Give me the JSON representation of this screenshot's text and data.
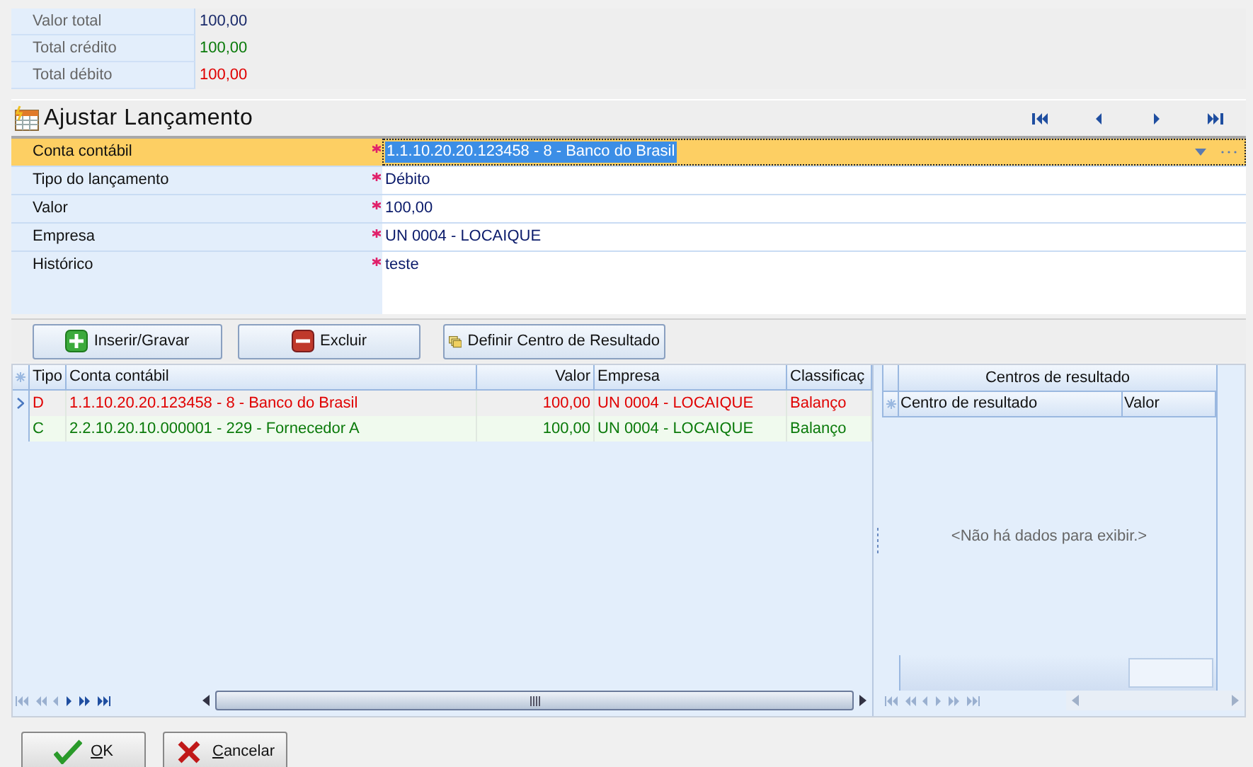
{
  "summary": [
    {
      "label": "Valor total",
      "value": "100,00",
      "kind": "total"
    },
    {
      "label": "Total crédito",
      "value": "100,00",
      "kind": "credit"
    },
    {
      "label": "Total débito",
      "value": "100,00",
      "kind": "debit"
    }
  ],
  "panel": {
    "title": "Ajustar Lançamento"
  },
  "form": {
    "fields": [
      {
        "label": "Conta contábil",
        "required": true,
        "value": "1.1.10.20.20.123458 - 8 - Banco do Brasil",
        "selected": true,
        "kind": "lookup"
      },
      {
        "label": "Tipo do lançamento",
        "required": true,
        "value": "Débito",
        "selected": false,
        "kind": "text"
      },
      {
        "label": "Valor",
        "required": true,
        "value": "100,00",
        "selected": false,
        "kind": "text"
      },
      {
        "label": "Empresa",
        "required": true,
        "value": "UN 0004 - LOCAIQUE",
        "selected": false,
        "kind": "text"
      },
      {
        "label": "Histórico",
        "required": true,
        "value": "teste",
        "selected": false,
        "kind": "memo"
      }
    ]
  },
  "toolbar": [
    {
      "label": "Inserir/Gravar",
      "kind": "add"
    },
    {
      "label": "Excluir",
      "kind": "delete"
    },
    {
      "label": "Definir Centro de Resultado",
      "kind": "define"
    }
  ],
  "entries": {
    "columns": [
      "Tipo",
      "Conta contábil",
      "Valor",
      "Empresa",
      "Classificaç"
    ],
    "rows": [
      {
        "cells": [
          "D",
          "1.1.10.20.20.123458 - 8 - Banco do Brasil",
          "100,00",
          "UN 0004 - LOCAIQUE",
          "Balanço"
        ],
        "kind": "debit",
        "selected": true
      },
      {
        "cells": [
          "C",
          "2.2.10.20.10.000001 - 229 - Fornecedor A",
          "100,00",
          "UN 0004 - LOCAIQUE",
          "Balanço"
        ],
        "kind": "credit",
        "selected": false
      }
    ]
  },
  "results": {
    "title": "Centros de resultado",
    "columns": [
      "Centro de resultado",
      "Valor"
    ],
    "empty_text": "<Não há dados para exibir.>"
  },
  "dialog_buttons": [
    {
      "label": "OK",
      "kind": "ok"
    },
    {
      "label": "Cancelar",
      "kind": "cancel"
    }
  ]
}
